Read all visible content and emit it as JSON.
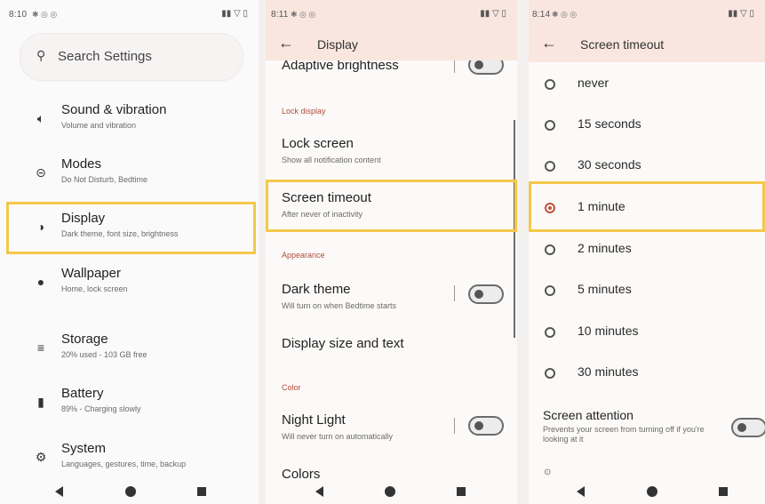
{
  "panel1": {
    "status": {
      "time": "8:10",
      "dots": "✱ ◎ ◎",
      "system": "▮▮ ▽ ▯"
    },
    "search": {
      "placeholder": "Search Settings",
      "icon": "search-icon"
    },
    "items": [
      {
        "title": "Sound & vibration",
        "subtitle": "Volume and vibration",
        "icon": "speaker-icon"
      },
      {
        "title": "Modes",
        "subtitle": "Do Not Disturb, Bedtime",
        "icon": "modes-icon"
      },
      {
        "title": "Display",
        "subtitle": "Dark theme, font size, brightness",
        "icon": "brightness-icon"
      },
      {
        "title": "Wallpaper",
        "subtitle": "Home, lock screen",
        "icon": "palette-icon"
      },
      {
        "title": "Storage",
        "subtitle": "20% used - 103 GB free",
        "icon": "storage-icon"
      },
      {
        "title": "Battery",
        "subtitle": "89% - Charging slowly",
        "icon": "battery-icon"
      },
      {
        "title": "System",
        "subtitle": "Languages, gestures, time, backup",
        "icon": "gear-icon"
      }
    ],
    "highlighted_item": "Display"
  },
  "panel2": {
    "status": {
      "time": "8:11",
      "dots": "✱ ◎ ◎",
      "system": "▮▮ ▽ ▯"
    },
    "appbar": {
      "title": "Display"
    },
    "adaptive_brightness": "Adaptive brightness",
    "categories": {
      "lock_display": "Lock display",
      "appearance": "Appearance",
      "color": "Color"
    },
    "lock_screen": {
      "title": "Lock screen",
      "subtitle": "Show all notification content"
    },
    "screen_timeout": {
      "title": "Screen timeout",
      "subtitle": "After never of inactivity"
    },
    "dark_theme": {
      "title": "Dark theme",
      "subtitle": "Will turn on when Bedtime starts",
      "enabled": false
    },
    "display_size": {
      "title": "Display size and text"
    },
    "night_light": {
      "title": "Night Light",
      "subtitle": "Will never turn on automatically",
      "enabled": false
    },
    "colors": {
      "title": "Colors"
    },
    "adaptive_brightness_enabled": false
  },
  "panel3": {
    "status": {
      "time": "8:14",
      "dots": "✱ ◎ ◎",
      "system": "▮▮ ▽ ▯"
    },
    "appbar": {
      "title": "Screen timeout"
    },
    "options": [
      "never",
      "15 seconds",
      "30 seconds",
      "1 minute",
      "2 minutes",
      "5 minutes",
      "10 minutes",
      "30 minutes"
    ],
    "selected": "1 minute",
    "screen_attention": {
      "title": "Screen attention",
      "subtitle": "Prevents your screen from turning off if you're looking at it",
      "enabled": false
    }
  },
  "colors": {
    "accent": "#c0503c",
    "highlight": "#f4c84a",
    "appbar": "#f8e6df",
    "category": "#b24b3e"
  }
}
